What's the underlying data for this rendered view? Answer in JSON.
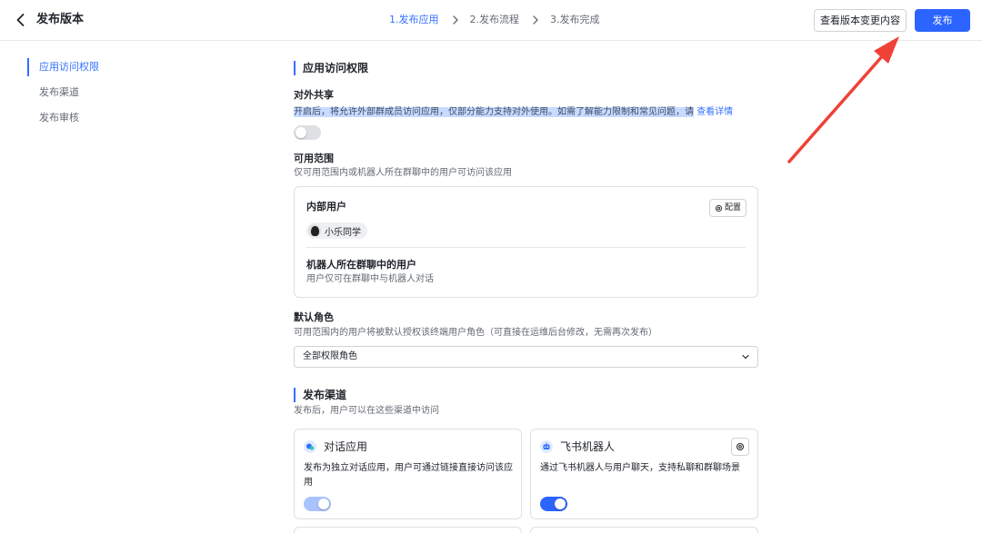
{
  "header": {
    "title": "发布版本",
    "steps": [
      "1.发布应用",
      "2.发布流程",
      "3.发布完成"
    ],
    "view_changes_label": "查看版本变更内容",
    "publish_label": "发布"
  },
  "sidebar": {
    "items": [
      {
        "label": "应用访问权限",
        "active": true
      },
      {
        "label": "发布渠道",
        "active": false
      },
      {
        "label": "发布审核",
        "active": false
      }
    ]
  },
  "access": {
    "section_title": "应用访问权限",
    "external_share": {
      "label": "对外共享",
      "desc": "开启后，将允许外部群成员访问应用，仅部分能力支持对外使用。如需了解能力限制和常见问题，请",
      "link": "查看详情",
      "enabled": false
    },
    "scope": {
      "label": "可用范围",
      "desc": "仅可用范围内或机器人所在群聊中的用户可访问该应用",
      "internal_users_label": "内部用户",
      "config_label": "配置",
      "user_chip": "小乐同学",
      "bot_users_label": "机器人所在群聊中的用户",
      "bot_users_desc": "用户仅可在群聊中与机器人对话"
    },
    "default_role": {
      "label": "默认角色",
      "desc": "可用范围内的用户将被默认授权该终端用户角色（可直接在运维后台修改，无需再次发布）",
      "selected": "全部权限角色"
    }
  },
  "channels": {
    "section_title": "发布渠道",
    "desc": "发布后，用户可以在这些渠道中访问",
    "items": [
      {
        "title": "对话应用",
        "desc": "发布为独立对话应用，用户可通过链接直接访问该应用",
        "enabled": true
      },
      {
        "title": "飞书机器人",
        "desc": "通过飞书机器人与用户聊天，支持私聊和群聊场景",
        "enabled": true
      }
    ]
  },
  "colors": {
    "accent": "#3370ff",
    "primary_button": "#2b64ff",
    "annotation_arrow": "#f04136"
  },
  "icons": [
    "chevron-left-icon",
    "chevron-right-icon",
    "chevron-down-icon",
    "gear-icon",
    "chat-app-icon",
    "robot-icon",
    "red-arrow-annotation"
  ]
}
